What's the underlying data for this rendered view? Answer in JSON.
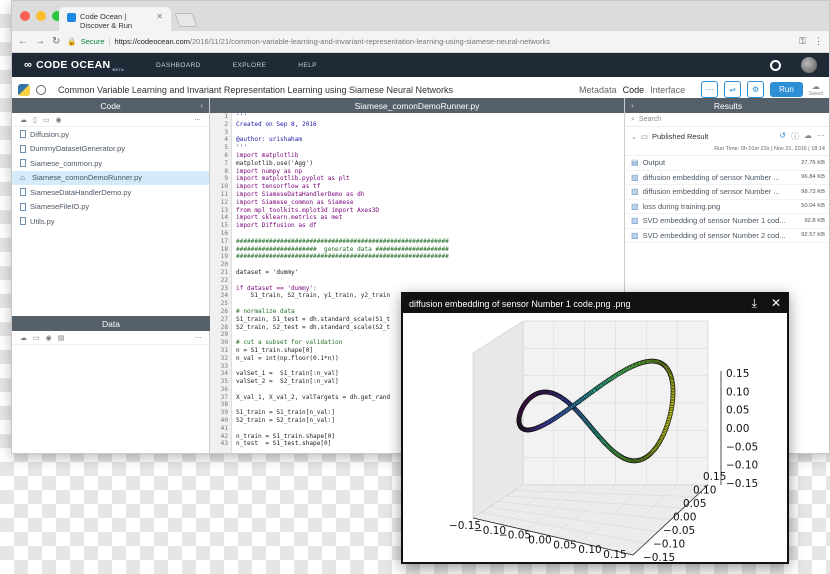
{
  "browser": {
    "tab_title": "Code Ocean | Discover & Run",
    "secure_label": "Secure",
    "url_host": "https://codeocean.com",
    "url_path": "/2016/11/21/common-variable-learning-and-invariant-representation-learning-using-siamese-neural-networks"
  },
  "appnav": {
    "logo_text": "CODE OCEAN",
    "logo_beta": "BETA",
    "links": [
      "DASHBOARD",
      "EXPLORE",
      "HELP"
    ]
  },
  "capsule": {
    "title": "Common Variable Learning and Invariant Representation Learning using Siamese Neural Networks",
    "tabs": [
      "Metadata",
      "Code",
      "Interface"
    ],
    "run_label": "Run",
    "saved_label": "Saved"
  },
  "code_panel": {
    "header": "Code",
    "files": [
      "Diffusion.py",
      "DummyDatasetGenerator.py",
      "Siamese_common.py",
      "Siamese_comonDemoRunner.py",
      "SiameseDataHandlerDemo.py",
      "SiameseFileIO.py",
      "Utils.py"
    ],
    "selected_index": 3
  },
  "data_panel": {
    "header": "Data"
  },
  "editor": {
    "filename": "Siamese_comonDemoRunner.py",
    "lines": [
      "'''",
      "Created on Sep 8, 2016",
      "",
      "@author: urishaham",
      "'''",
      "import matplotlib",
      "matplotlib.use('Agg')",
      "import numpy as np",
      "import matplotlib.pyplot as plt",
      "import tensorflow as tf",
      "import SiameseDataHandlerDemo as dh",
      "import Siamese_common as Siamese",
      "from mpl_toolkits.mplot3d import Axes3D",
      "import sklearn.metrics as met",
      "import Diffusion as df",
      "",
      "##########################################################",
      "######################  generate data ####################",
      "##########################################################",
      "",
      "dataset = 'dummy'",
      "",
      "if dataset == 'dummy':",
      "    S1_train, S2_train, y1_train, y2_train",
      "",
      "# normalize data",
      "S1_train, S1_test = dh.standard_scale(S1_t",
      "S2_train, S2_test = dh.standard_scale(S2_t",
      "",
      "# cut a subset for validation",
      "n = S1_train.shape[0]",
      "n_val = int(np.floor(0.1*n))",
      "",
      "valSet_1 =  S1_train[:n_val]",
      "valSet_2 =  S2_train[:n_val]",
      "",
      "X_val_1, X_val_2, valTargets = dh.get_rand",
      "",
      "S1_train = S1_train[n_val:]",
      "S2_train = S2_train[n_val:]",
      "",
      "n_train = S1_train.shape[0]",
      "n_test  = S1_test.shape[0]"
    ]
  },
  "results": {
    "header": "Results",
    "search_placeholder": "Search",
    "published_label": "Published Result",
    "run_time": "Run Time: 0h 01m 22s  |  Nov 21, 2016  |  18:14",
    "items": [
      {
        "name": "Output",
        "size": "27.76 KB",
        "icon": "text-file-icon"
      },
      {
        "name": "diffusion embedding of sensor Number ...",
        "size": "96.84 KB",
        "icon": "image-file-icon"
      },
      {
        "name": "diffusion embedding of sensor Number ...",
        "size": "98.73 KB",
        "icon": "image-file-icon"
      },
      {
        "name": "loss during training.png",
        "size": "50.04 KB",
        "icon": "image-file-icon"
      },
      {
        "name": "SVD embedding of sensor Number 1 cod...",
        "size": "92.8 KB",
        "icon": "image-file-icon"
      },
      {
        "name": "SVD embedding of sensor Number 2 cod...",
        "size": "92.57 KB",
        "icon": "image-file-icon"
      }
    ]
  },
  "popup": {
    "title": "diffusion embedding of sensor Number 1 code.png .png",
    "chart_data": {
      "type": "scatter",
      "projection": "3d",
      "x_ticks": [
        "-0.15",
        "-0.10",
        "-0.05",
        "0.00",
        "0.05",
        "0.10",
        "0.15"
      ],
      "y_ticks": [
        "-0.15",
        "-0.10",
        "-0.05",
        "0.00",
        "0.05",
        "0.10",
        "0.15"
      ],
      "z_ticks": [
        "-0.15",
        "-0.10",
        "-0.05",
        "0.00",
        "0.05",
        "0.10",
        "0.15"
      ],
      "xlim": [
        -0.15,
        0.15
      ],
      "ylim": [
        -0.15,
        0.15
      ],
      "zlim": [
        -0.15,
        0.15
      ],
      "shape": "figure-eight",
      "colormap": [
        "#7a0d8c",
        "#3b4bc7",
        "#22a08a",
        "#66cc33",
        "#d9e021"
      ],
      "grid": true
    }
  }
}
